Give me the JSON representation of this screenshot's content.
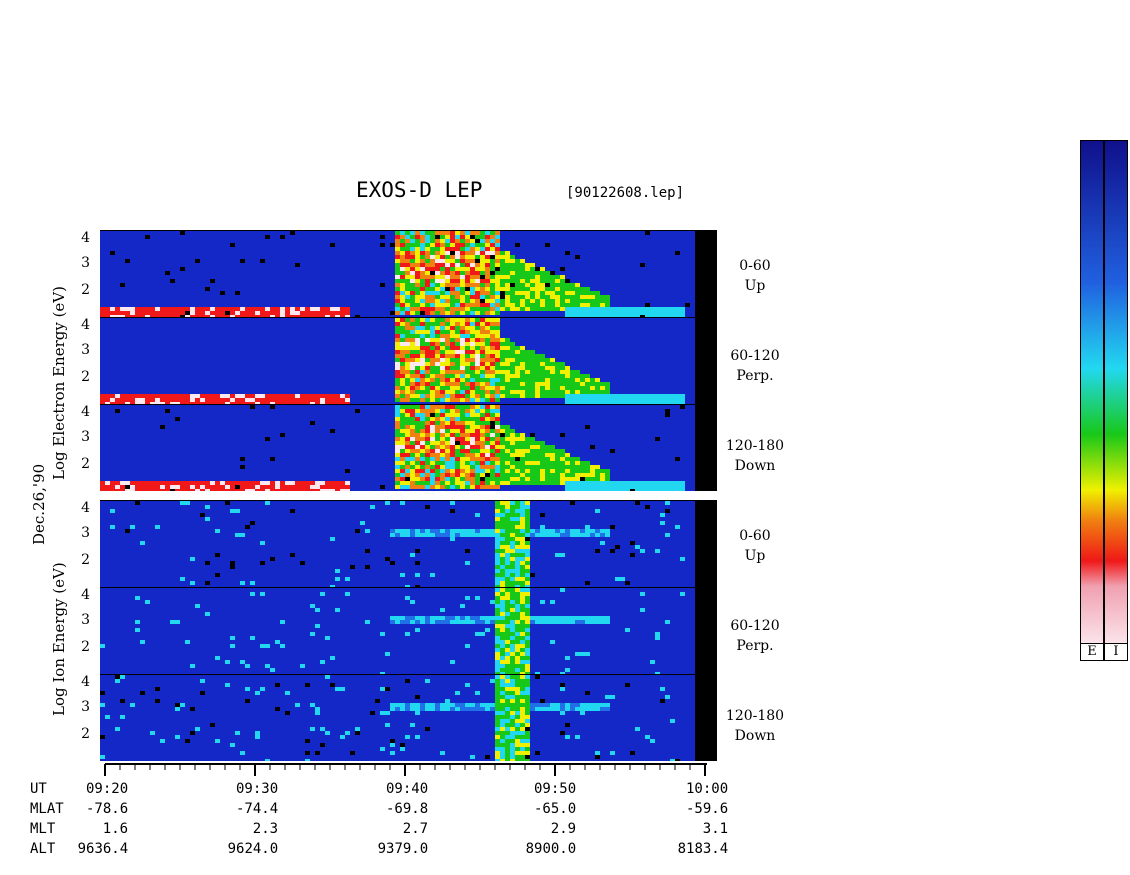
{
  "title": "EXOS-D LEP",
  "file_label": "[90122608.lep]",
  "date_label": "Dec.26,'90",
  "electron_label": {
    "log": "Log",
    "species": "Electron",
    "energy": "Energy (eV)"
  },
  "ion_label": {
    "log": "Log",
    "species": "Ion",
    "energy": "Energy (eV)"
  },
  "pitch_angles": [
    {
      "range": "0-60",
      "dir": "Up"
    },
    {
      "range": "60-120",
      "dir": "Perp."
    },
    {
      "range": "120-180",
      "dir": "Down"
    }
  ],
  "y_ticks": [
    "4",
    "3",
    "2"
  ],
  "colorbar_labels": [
    "E",
    "I"
  ],
  "colors": {
    "scale_low": "#10108c",
    "scale_mid": "#22d8f0",
    "scale_green": "#18c818",
    "scale_yellow": "#f0f000",
    "scale_red": "#f01818",
    "scale_high": "#fce8ee"
  },
  "axis_rows": [
    {
      "name": "UT",
      "values": [
        "09:20",
        "09:30",
        "09:40",
        "09:50",
        "10:00"
      ]
    },
    {
      "name": "MLAT",
      "values": [
        "-78.6",
        "-74.4",
        "-69.8",
        "-65.0",
        "-59.6"
      ]
    },
    {
      "name": "MLT",
      "values": [
        "1.6",
        "2.3",
        "2.7",
        "2.9",
        "3.1"
      ]
    },
    {
      "name": "ALT",
      "values": [
        "9636.4",
        "9624.0",
        "9379.0",
        "8900.0",
        "8183.4"
      ]
    }
  ],
  "chart_data": {
    "type": "heatmap",
    "x": [
      "09:20",
      "09:30",
      "09:40",
      "09:50",
      "10:00"
    ],
    "ylabel": "Log Energy (eV)",
    "yticks": [
      2,
      3,
      4
    ],
    "panels": [
      {
        "species": "Electron",
        "pitch": "0-60 Up"
      },
      {
        "species": "Electron",
        "pitch": "60-120 Perp."
      },
      {
        "species": "Electron",
        "pitch": "120-180 Down"
      },
      {
        "species": "Ion",
        "pitch": "0-60 Up"
      },
      {
        "species": "Ion",
        "pitch": "60-120 Perp."
      },
      {
        "species": "Ion",
        "pitch": "120-180 Down"
      }
    ]
  }
}
